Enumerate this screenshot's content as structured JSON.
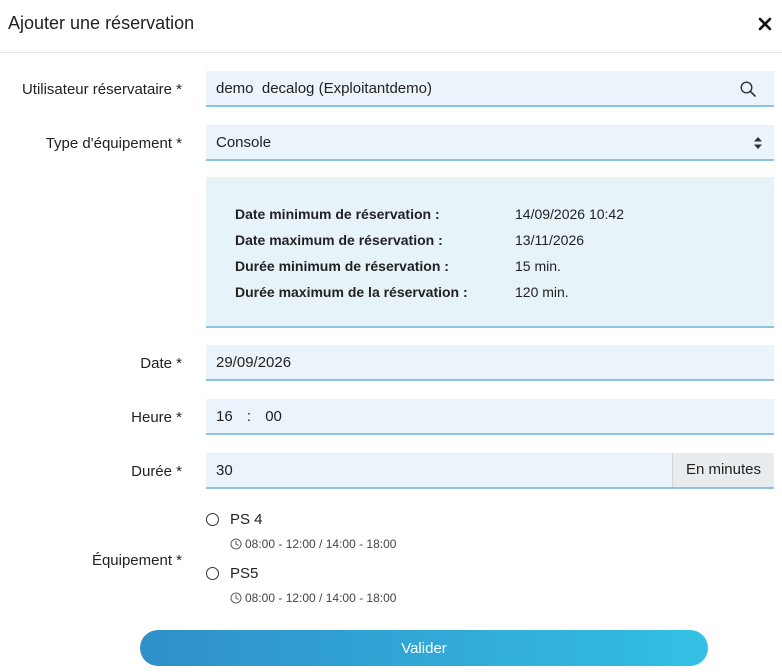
{
  "header": {
    "title": "Ajouter une réservation",
    "close_symbol": "✕"
  },
  "form": {
    "user": {
      "label": "Utilisateur réservataire *",
      "value": "demo  decalog (Exploitantdemo)",
      "icon": "search-icon"
    },
    "equipment_type": {
      "label": "Type d'équipement *",
      "value": "Console"
    },
    "info": [
      {
        "key": "Date minimum de réservation :",
        "value": "14/09/2026 10:42"
      },
      {
        "key": "Date maximum de réservation :",
        "value": "13/11/2026"
      },
      {
        "key": "Durée minimum de réservation :",
        "value": "15 min."
      },
      {
        "key": "Durée maximum de la réservation :",
        "value": "120 min."
      }
    ],
    "date": {
      "label": "Date *",
      "value": "29/09/2026"
    },
    "time": {
      "label": "Heure *",
      "hour": "16",
      "separator": ":",
      "minute": "00"
    },
    "duration": {
      "label": "Durée *",
      "value": "30",
      "unit": "En minutes"
    },
    "equipment": {
      "label": "Équipement *",
      "options": [
        {
          "name": "PS 4",
          "slots": "08:00 - 12:00 / 14:00 - 18:00"
        },
        {
          "name": "PS5",
          "slots": "08:00 - 12:00 / 14:00 - 18:00"
        }
      ]
    },
    "submit_label": "Valider"
  },
  "colors": {
    "field_bg": "#eaf4fa",
    "field_border": "#8cc2e2",
    "button_start": "#2f8fc9",
    "button_end": "#33c0e4"
  }
}
